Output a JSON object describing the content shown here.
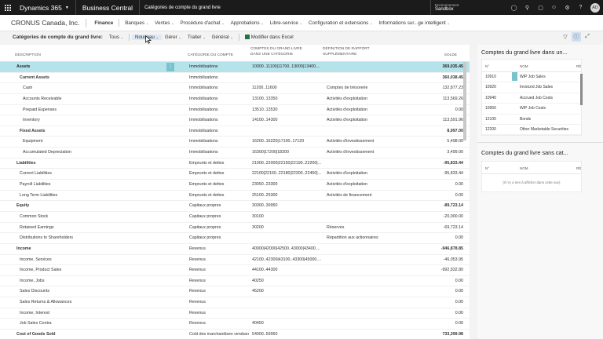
{
  "topbar": {
    "app_title": "Dynamics 365",
    "product": "Business Central",
    "page_title": "Catégories de compte du grand livre",
    "environment_label": "Environnement",
    "environment_name": "Sandbox",
    "icons": [
      "bulb-icon",
      "search-icon",
      "chat-icon",
      "smiley-icon",
      "gear-icon",
      "help-icon"
    ],
    "avatar_initials": "AD"
  },
  "nav": {
    "company": "CRONUS Canada, Inc.",
    "items": [
      "Finance",
      "Banques",
      "Ventes",
      "Procédure d'achat",
      "Approbations",
      "Libre-service",
      "Configuration et extensions",
      "Informations sur...ge intelligent"
    ]
  },
  "actions": {
    "page_title": "Catégories de compte du grand livre:",
    "filter": "Tous",
    "new": "Nouveau",
    "manage": "Gérer",
    "process": "Traiter",
    "general": "Général",
    "excel": "Modifier dans Excel"
  },
  "columns": {
    "description": "DESCRIPTION",
    "category": "CATÉGORIE DU COMPTE",
    "accounts_l1": "COMPTES DU GRAND LIVRE",
    "accounts_l2": "DANS UNE CATÉGORIE",
    "report_l1": "DÉFINITION DE RAPPORT",
    "report_l2": "SUPPLÉMENTAIRE",
    "balance": "SOLDE"
  },
  "rows": [
    {
      "desc": "Assets",
      "indent": 0,
      "bold": true,
      "selected": true,
      "category": "Immobilisations",
      "accounts": "10000..11100|11700..13000|13400....",
      "report": "",
      "balance": "369,035.45"
    },
    {
      "desc": "Current Assets",
      "indent": 1,
      "bold": true,
      "category": "Immobilisations",
      "accounts": "",
      "report": "",
      "balance": "360,038.45"
    },
    {
      "desc": "Cash",
      "indent": 2,
      "category": "Immobilisations",
      "accounts": "11200..11600",
      "report": "Comptes de trésorerie",
      "balance": "132,877.23"
    },
    {
      "desc": "Accounts Receivable",
      "indent": 2,
      "category": "Immobilisations",
      "accounts": "13100..13350",
      "report": "Activités d'exploitation",
      "balance": "113,569.26"
    },
    {
      "desc": "Prepaid Expenses",
      "indent": 2,
      "category": "Immobilisations",
      "accounts": "13510..13530",
      "report": "Activités d'exploitation",
      "balance": "0.00"
    },
    {
      "desc": "Inventory",
      "indent": 2,
      "category": "Immobilisations",
      "accounts": "14100..14300",
      "report": "Activités d'exploitation",
      "balance": "113,591.96"
    },
    {
      "desc": "Fixed Assets",
      "indent": 1,
      "bold": true,
      "category": "Immobilisations",
      "accounts": "",
      "report": "",
      "balance": "8,997.00"
    },
    {
      "desc": "Equipment",
      "indent": 2,
      "category": "Immobilisations",
      "accounts": "16200..16220|17100..17120",
      "report": "Activités d'investissement",
      "balance": "5,498.00"
    },
    {
      "desc": "Accumulated Depreciation",
      "indent": 2,
      "category": "Immobilisations",
      "accounts": "16300|17200|18200",
      "report": "Activités d'investissement",
      "balance": "3,499.00"
    },
    {
      "desc": "Liabilities",
      "indent": 0,
      "bold": true,
      "category": "Emprunts et dettes",
      "accounts": "21000..22000|22150|22190..22200|...",
      "report": "",
      "balance": "-95,833.44"
    },
    {
      "desc": "Current Liabilities",
      "indent": 1,
      "category": "Emprunts et dettes",
      "accounts": "22100|22160..22180|22300..22450|...",
      "report": "Activités d'exploitation",
      "balance": "-95,833.44"
    },
    {
      "desc": "Payroll Liabilities",
      "indent": 1,
      "category": "Emprunts et dettes",
      "accounts": "23050..23300",
      "report": "Activités d'exploitation",
      "balance": "0.00"
    },
    {
      "desc": "Long Term Liabilities",
      "indent": 1,
      "category": "Emprunts et dettes",
      "accounts": "25100..25300",
      "report": "Activités de financement",
      "balance": "0.00"
    },
    {
      "desc": "Equity",
      "indent": 0,
      "bold": true,
      "category": "Capitaux propres",
      "accounts": "30300..39950",
      "report": "",
      "balance": "-89,723.14"
    },
    {
      "desc": "Common Stock",
      "indent": 1,
      "category": "Capitaux propres",
      "accounts": "30100",
      "report": "",
      "balance": "-20,000.00"
    },
    {
      "desc": "Retained Earnings",
      "indent": 1,
      "category": "Capitaux propres",
      "accounts": "30200",
      "report": "Réserves",
      "balance": "-69,723.14"
    },
    {
      "desc": "Distributions to Shareholders",
      "indent": 1,
      "category": "Capitaux propres",
      "accounts": "",
      "report": "Répartition aux actionnaires",
      "balance": "0.00"
    },
    {
      "desc": "Income",
      "indent": 0,
      "bold": true,
      "category": "Revenus",
      "accounts": "40000|42000|42500..43000|43400....",
      "report": "",
      "balance": "-946,878.85"
    },
    {
      "desc": "Income, Services",
      "indent": 1,
      "category": "Revenus",
      "accounts": "42100..42300|43100..43300|45000....",
      "report": "",
      "balance": "-46,053.95"
    },
    {
      "desc": "Income, Product Sales",
      "indent": 1,
      "category": "Revenus",
      "accounts": "44100..44300",
      "report": "",
      "balance": "-992,932.80"
    },
    {
      "desc": "Income, Jobs",
      "indent": 1,
      "category": "Revenus",
      "accounts": "40250",
      "report": "",
      "balance": "0.00"
    },
    {
      "desc": "Sales Discounts",
      "indent": 1,
      "category": "Revenus",
      "accounts": "45200",
      "report": "",
      "balance": "0.00"
    },
    {
      "desc": "Sales Returns & Allowances",
      "indent": 1,
      "category": "Revenus",
      "accounts": "",
      "report": "",
      "balance": "0.00"
    },
    {
      "desc": "Income, Interest",
      "indent": 1,
      "category": "Revenus",
      "accounts": "",
      "report": "",
      "balance": "0.00"
    },
    {
      "desc": "Job Sales Contra",
      "indent": 1,
      "category": "Revenus",
      "accounts": "40450",
      "report": "",
      "balance": "0.00"
    },
    {
      "desc": "Cost of Goods Sold",
      "indent": 0,
      "bold": true,
      "category": "Coût des marchandises vendues",
      "accounts": "54000..59950",
      "report": "",
      "balance": "733,399.98"
    }
  ],
  "factbox1": {
    "title": "Comptes du grand livre dans un...",
    "col_no": "N°",
    "col_name": "NOM",
    "col_re": "RÉ",
    "rows": [
      {
        "no": "10910",
        "name": "WIP Job Sales",
        "selected": true
      },
      {
        "no": "10920",
        "name": "Invoiced Job Sales"
      },
      {
        "no": "10940",
        "name": "Accrued Job Costs"
      },
      {
        "no": "10950",
        "name": "WIP Job Costs"
      },
      {
        "no": "12100",
        "name": "Bonds"
      },
      {
        "no": "12200",
        "name": "Other Marketable Securities"
      }
    ]
  },
  "factbox2": {
    "title": "Comptes du grand livre sans cat...",
    "col_no": "N°",
    "col_name": "NOM",
    "col_re": "RÉ",
    "empty": "(Il n'y a rien à afficher dans cette vue)"
  }
}
